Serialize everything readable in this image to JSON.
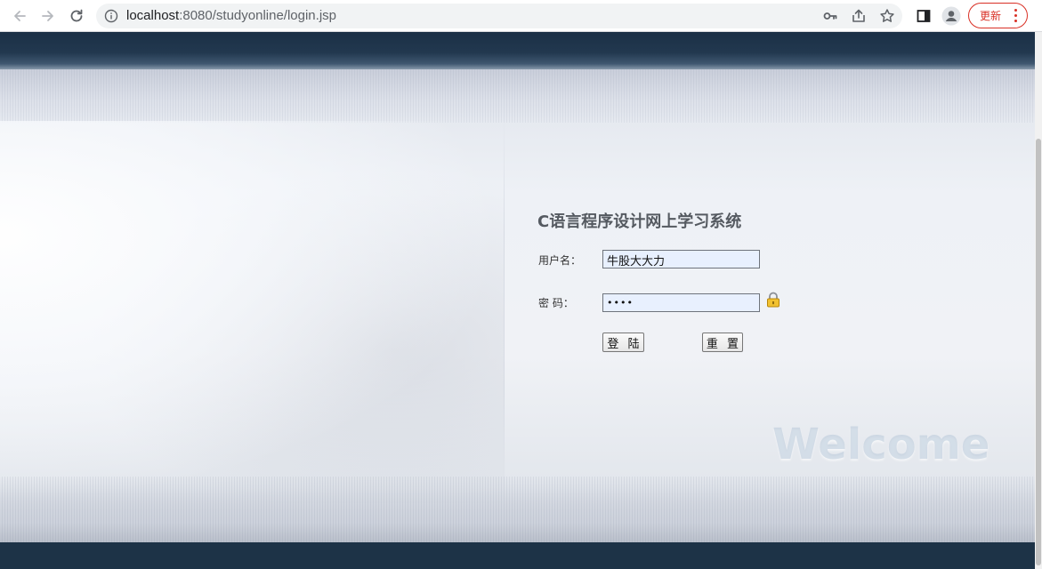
{
  "browser": {
    "url_host": "localhost",
    "url_rest": ":8080/studyonline/login.jsp",
    "update_label": "更新",
    "icons": [
      "back-icon",
      "forward-icon",
      "reload-icon",
      "info-icon",
      "key-icon",
      "share-icon",
      "star-icon",
      "side-panel-icon",
      "profile-icon",
      "menu-dots-icon"
    ]
  },
  "login": {
    "title": "C语言程序设计网上学习系统",
    "username_label": "用户名：",
    "username_value": "牛股大大力",
    "password_label": "密 码：",
    "password_mask": "••••",
    "login_button": "登 陆",
    "reset_button": "重 置"
  },
  "decor": {
    "welcome_text": "Welcome"
  },
  "colors": {
    "header_band": "#1b3046",
    "footer_band": "#1d3347",
    "update_accent": "#d93025"
  }
}
